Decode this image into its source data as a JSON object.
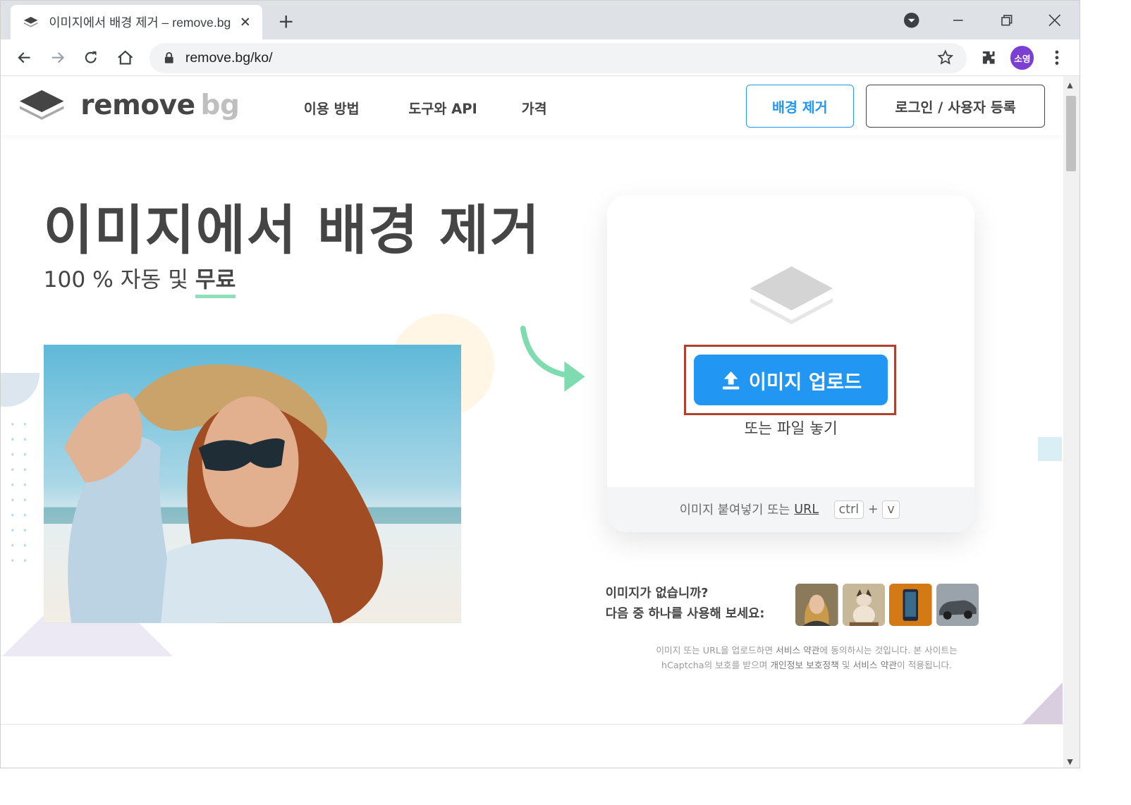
{
  "browser": {
    "tab_title": "이미지에서 배경 제거 – remove.bg",
    "url": "remove.bg/ko/",
    "profile_initials": "소영"
  },
  "header": {
    "logo_primary": "remove",
    "logo_secondary": "bg",
    "nav": [
      "이용 방법",
      "도구와 API",
      "가격"
    ],
    "cta_primary": "배경 제거",
    "cta_login": "로그인 / 사용자 등록"
  },
  "hero": {
    "title": "이미지에서 배경 제거",
    "subtitle_prefix": "100 % 자동 및",
    "subtitle_strong": "무료"
  },
  "upload": {
    "button_label": "이미지 업로드",
    "drop_hint": "또는 파일 놓기",
    "paste_hint": "이미지 붙여넣기 또는",
    "paste_url": "URL",
    "key_ctrl": "ctrl",
    "key_plus": "+",
    "key_v": "v"
  },
  "samples": {
    "line1": "이미지가 없습니까?",
    "line2": "다음 중 하나를 사용해 보세요:"
  },
  "legal": {
    "line1_a": "이미지 또는 URL을 업로드하면",
    "line1_b": "서비스 약관",
    "line1_c": "에 동의하시는 것입니다. 본 사이트는",
    "line2_a": "hCaptcha의 보호를 받으며",
    "line2_b": "개인정보 보호정책",
    "line2_c": "및",
    "line2_d": "서비스 약관",
    "line2_e": "이 적용됩니다."
  },
  "colors": {
    "accent": "#2196f3",
    "text": "#454545",
    "highlight": "#b0412e",
    "underline": "#8fdfbd"
  }
}
